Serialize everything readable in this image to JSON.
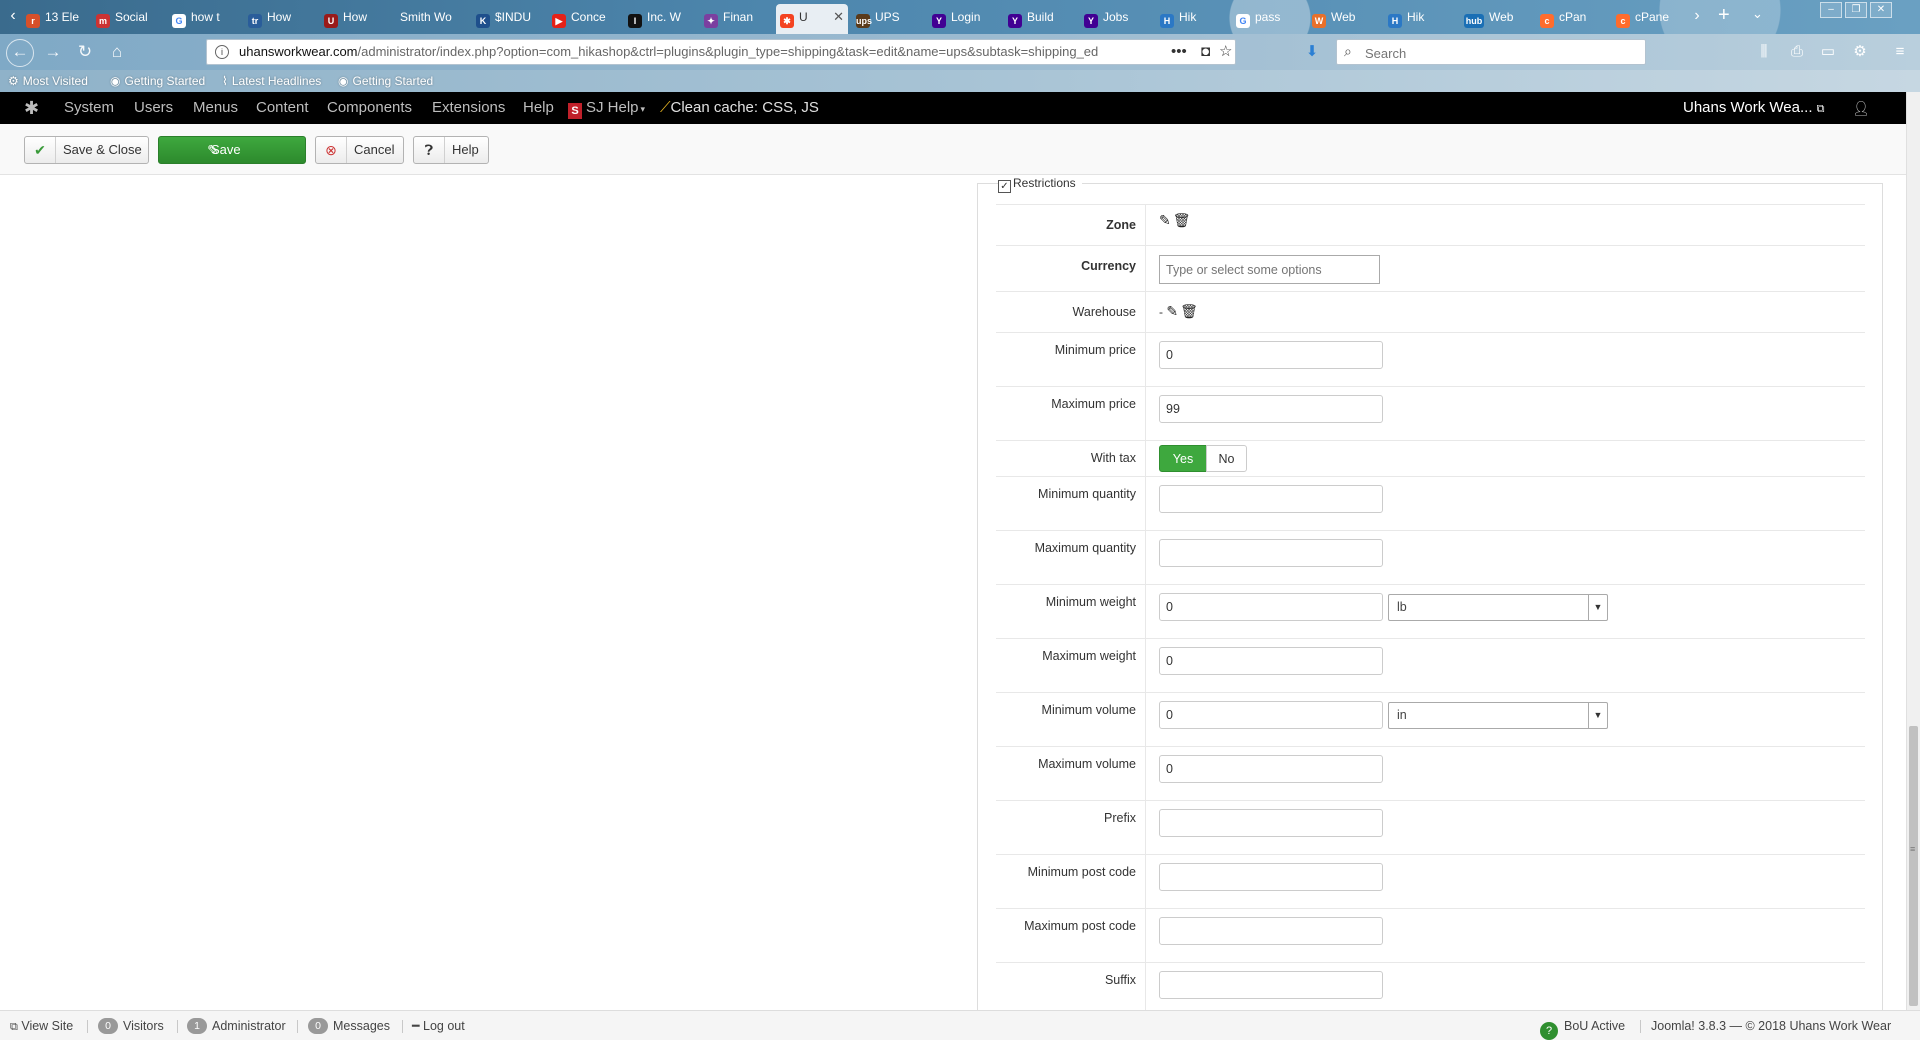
{
  "browser": {
    "tabs": [
      {
        "label": "13 Ele",
        "icon": "tab-favicon"
      },
      {
        "label": "Social",
        "icon": "tab-favicon"
      },
      {
        "label": "how t",
        "icon": "google-icon"
      },
      {
        "label": "How",
        "icon": "tab-favicon"
      },
      {
        "label": "How",
        "icon": "tab-favicon"
      },
      {
        "label": "Smith Wo",
        "icon": ""
      },
      {
        "label": "$INDU",
        "icon": "tab-favicon"
      },
      {
        "label": "Conce",
        "icon": "youtube-icon"
      },
      {
        "label": "Inc. W",
        "icon": "tab-favicon"
      },
      {
        "label": "Finan",
        "icon": "tab-favicon"
      },
      {
        "label": "U",
        "icon": "joomla-icon"
      },
      {
        "label": "UPS",
        "icon": "ups-icon"
      },
      {
        "label": "Login",
        "icon": "yahoo-icon"
      },
      {
        "label": "Build",
        "icon": "yahoo-icon"
      },
      {
        "label": "Jobs",
        "icon": "yahoo-icon"
      },
      {
        "label": "Hik",
        "icon": "tab-favicon"
      },
      {
        "label": "pass",
        "icon": "google-icon"
      },
      {
        "label": "Web",
        "icon": "tab-favicon"
      },
      {
        "label": "Hik",
        "icon": "tab-favicon"
      },
      {
        "label": "Web",
        "icon": "hub-icon"
      },
      {
        "label": "cPan",
        "icon": "tab-favicon"
      },
      {
        "label": "cPane",
        "icon": "tab-favicon"
      }
    ],
    "hub_badge": "hub",
    "url_host": "uhansworkwear.com",
    "url_path": "/administrator/index.php?option=com_hikashop&ctrl=plugins&plugin_type=shipping&task=edit&name=ups&subtask=shipping_ed",
    "search_placeholder": "Search",
    "bookmarks": [
      "Most Visited",
      "Getting Started",
      "Latest Headlines",
      "Getting Started"
    ]
  },
  "admin_menu": {
    "items": [
      "System",
      "Users",
      "Menus",
      "Content",
      "Components",
      "Extensions",
      "Help"
    ],
    "sj_badge": "S",
    "sj_help": "SJ Help",
    "clean_cache": "Clean cache: CSS, JS",
    "site_name": "Uhans Work Wea..."
  },
  "toolbar": {
    "save_close": "Save & Close",
    "save": "Save",
    "cancel": "Cancel",
    "help": "Help"
  },
  "restrictions": {
    "legend": "Restrictions",
    "legend_checked": "✓",
    "zone_label": "Zone",
    "currency_label": "Currency",
    "currency_placeholder": "Type or select some options",
    "warehouse_label": "Warehouse",
    "warehouse_value": "-",
    "min_price_label": "Minimum price",
    "min_price": "0",
    "max_price_label": "Maximum price",
    "max_price": "99",
    "with_tax_label": "With tax",
    "with_tax_yes": "Yes",
    "with_tax_no": "No",
    "with_tax_selected": "Yes",
    "min_qty_label": "Minimum quantity",
    "min_qty": "",
    "max_qty_label": "Maximum quantity",
    "max_qty": "",
    "min_weight_label": "Minimum weight",
    "min_weight": "0",
    "weight_unit": "lb",
    "max_weight_label": "Maximum weight",
    "max_weight": "0",
    "min_volume_label": "Minimum volume",
    "min_volume": "0",
    "volume_unit": "in",
    "max_volume_label": "Maximum volume",
    "max_volume": "0",
    "prefix_label": "Prefix",
    "prefix": "",
    "min_postcode_label": "Minimum post code",
    "min_postcode": "",
    "max_postcode_label": "Maximum post code",
    "max_postcode": "",
    "suffix_label": "Suffix",
    "suffix": ""
  },
  "status_bar": {
    "view_site": "View Site",
    "visitors_count": "0",
    "visitors": "Visitors",
    "admin_count": "1",
    "admin": "Administrator",
    "messages_count": "0",
    "messages": "Messages",
    "logout": "Log out",
    "bou_badge": "?",
    "bou": "BoU Active",
    "version": "Joomla! 3.8.3 — © 2018 Uhans Work Wear"
  },
  "colors": {
    "save_green": "#3ea83e",
    "admin_bar": "#000000"
  }
}
